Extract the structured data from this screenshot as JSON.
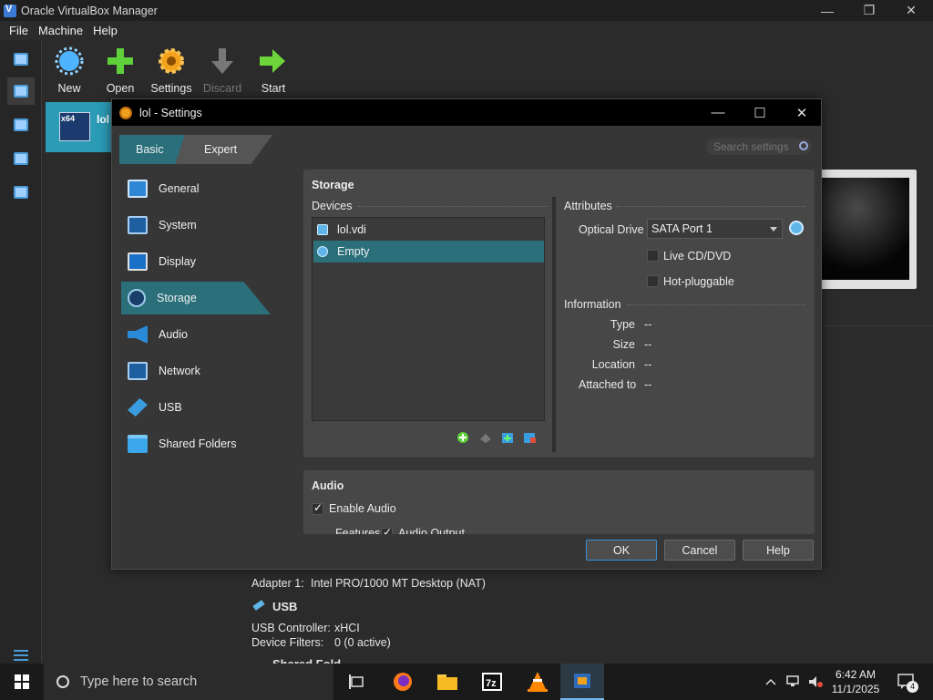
{
  "window": {
    "title": "Oracle VirtualBox Manager"
  },
  "menu": [
    "File",
    "Machine",
    "Help"
  ],
  "toolbar": [
    {
      "label": "New",
      "enabled": true,
      "icon": "new-sun-icon"
    },
    {
      "label": "Open",
      "enabled": true,
      "icon": "open-plus-icon"
    },
    {
      "label": "Settings",
      "enabled": true,
      "icon": "gear-icon"
    },
    {
      "label": "Discard",
      "enabled": false,
      "icon": "discard-arrow-icon"
    },
    {
      "label": "Start",
      "enabled": true,
      "icon": "start-arrow-icon"
    }
  ],
  "vm": {
    "name": "lol",
    "badge": "x64"
  },
  "details": {
    "adapter1_label": "Adapter 1:",
    "adapter1_value": "Intel PRO/1000 MT Desktop (NAT)",
    "usb_header": "USB",
    "usb_controller_label": "USB Controller:",
    "usb_controller_value": "xHCI",
    "device_filters_label": "Device Filters:",
    "device_filters_value": "0 (0 active)",
    "shared_header_partial": "Shared Fold"
  },
  "dialog": {
    "title": "lol - Settings",
    "mode_tabs": [
      "Basic",
      "Expert"
    ],
    "active_mode": "Basic",
    "search_placeholder": "Search settings",
    "nav": [
      "General",
      "System",
      "Display",
      "Storage",
      "Audio",
      "Network",
      "USB",
      "Shared Folders"
    ],
    "selected_nav": "Storage",
    "storage": {
      "title": "Storage",
      "devices_label": "Devices",
      "devices": [
        {
          "label": "lol.vdi",
          "selected": false
        },
        {
          "label": "Empty",
          "selected": true
        }
      ],
      "attributes_label": "Attributes",
      "optical_drive_label": "Optical Drive",
      "optical_drive_value": "SATA Port 1",
      "live_cd_label": "Live CD/DVD",
      "live_cd_checked": false,
      "hot_pluggable_label": "Hot-pluggable",
      "hot_pluggable_checked": false,
      "information_label": "Information",
      "info": [
        {
          "label": "Type",
          "value": "--"
        },
        {
          "label": "Size",
          "value": "--"
        },
        {
          "label": "Location",
          "value": "--"
        },
        {
          "label": "Attached to",
          "value": "--"
        }
      ]
    },
    "audio": {
      "title": "Audio",
      "enable_audio_label": "Enable Audio",
      "enable_audio_checked": true,
      "features_partial": "Features",
      "audio_output_partial": "Audio Output"
    },
    "buttons": {
      "ok": "OK",
      "cancel": "Cancel",
      "help": "Help"
    }
  },
  "taskbar": {
    "search_placeholder": "Type here to search",
    "time": "6:42 AM",
    "date": "11/1/2025",
    "notification_count": "4"
  },
  "colors": {
    "selection": "#2a6f7a",
    "accent": "#2c9bb5"
  }
}
